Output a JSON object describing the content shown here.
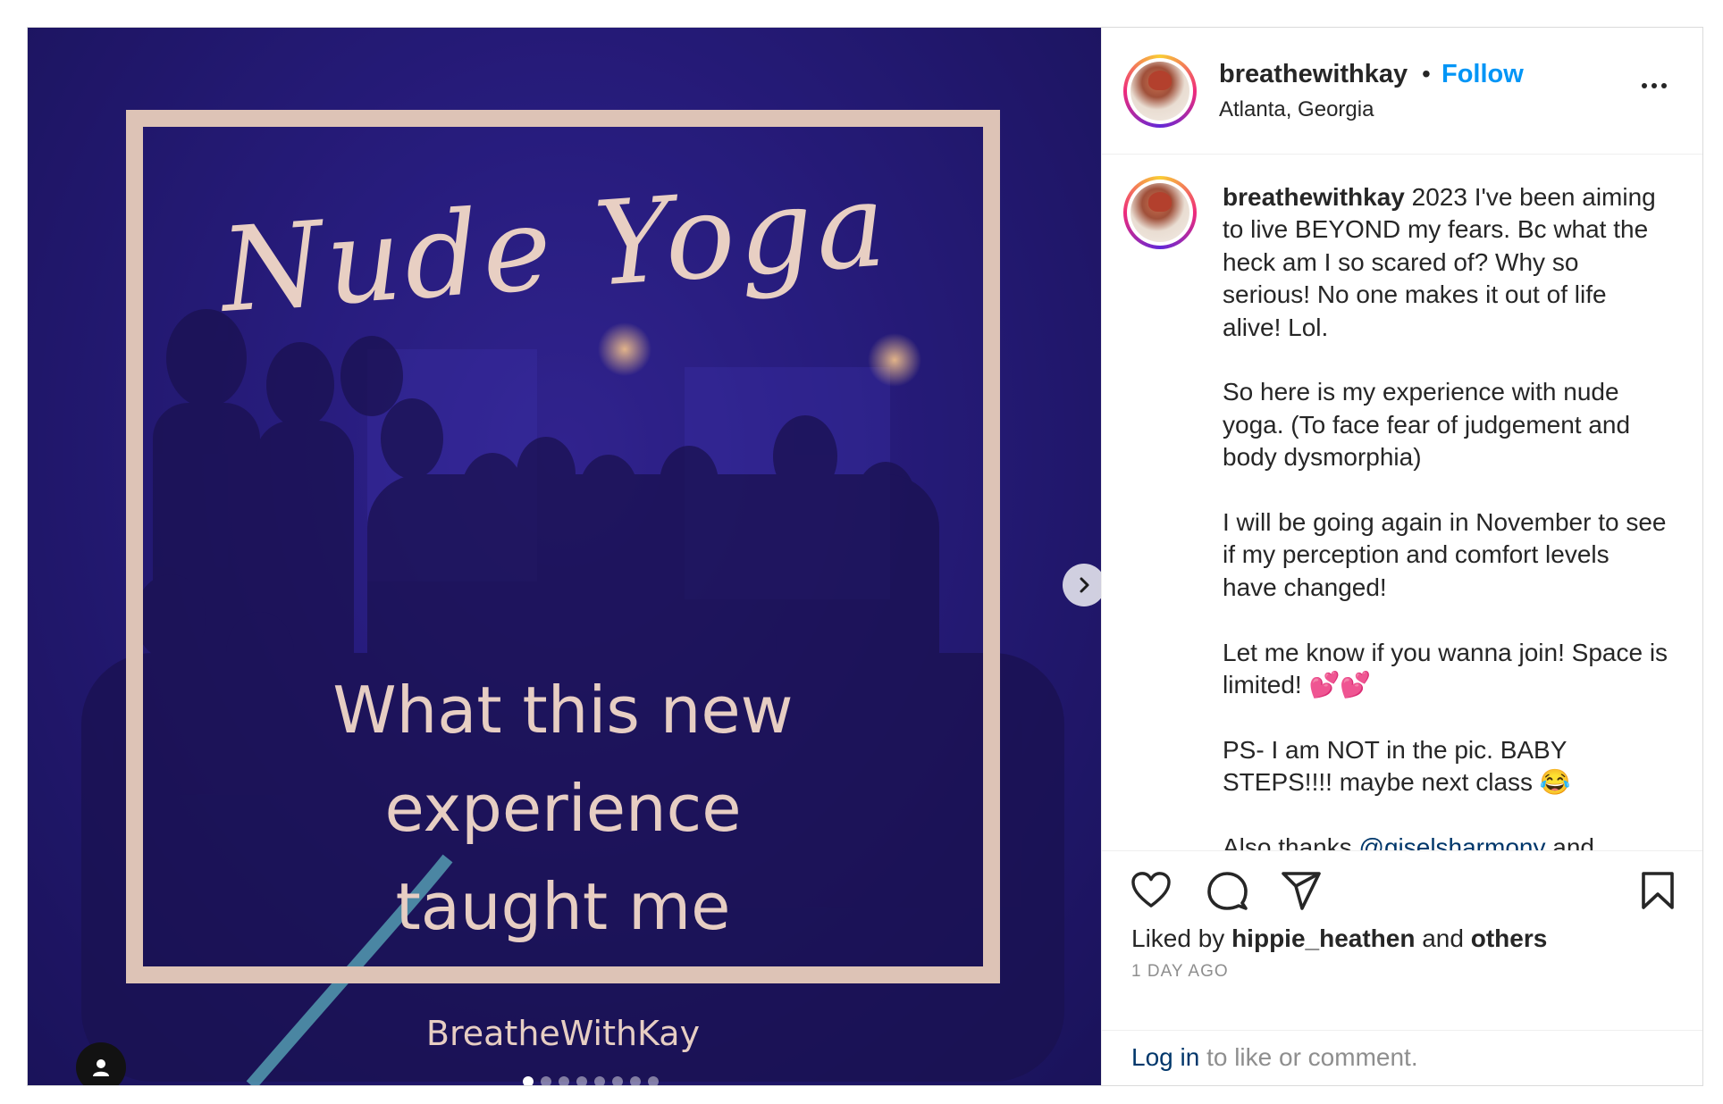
{
  "media": {
    "title_script": "Nude Yoga",
    "subtitle_lines": [
      "What this new",
      "experience",
      "taught me"
    ],
    "brand": "BreatheWithKay",
    "carousel_count": 8,
    "carousel_active": 0
  },
  "header": {
    "username": "breathewithkay",
    "separator": "•",
    "follow": "Follow",
    "location": "Atlanta, Georgia"
  },
  "caption": {
    "username": "breathewithkay",
    "paragraphs": [
      "2023 I've been aiming to live BEYOND my fears. Bc what the heck am I so scared of? Why so serious! No one makes it out of life alive! Lol.",
      "So here is my experience with nude yoga. (To face fear of judgement and body dysmorphia)",
      "I will be going again in November to see if my perception and comfort levels have changed!",
      "Let me know if you wanna join! Space is limited! 💕💕",
      "PS- I am NOT in the pic. BABY STEPS!!!! maybe next class 😂"
    ],
    "last_prefix": "Also thanks ",
    "last_mention": "@giselsharmony",
    "last_suffix": " and"
  },
  "likes": {
    "prefix": "Liked by ",
    "user": "hippie_heathen",
    "middle": " and ",
    "others": "others"
  },
  "date": "1 DAY AGO",
  "login": {
    "link": "Log in",
    "rest": " to like or comment."
  },
  "icons": {
    "like": "heart-icon",
    "comment": "comment-icon",
    "share": "share-icon",
    "save": "bookmark-icon",
    "next": "chevron-right-icon",
    "user_tag": "user-icon"
  },
  "colors": {
    "follow": "#0095f6",
    "mention": "#00376b",
    "frame": "#ddc3b6",
    "overlay_text": "#e7cec3",
    "muted": "#8e8e8e"
  }
}
